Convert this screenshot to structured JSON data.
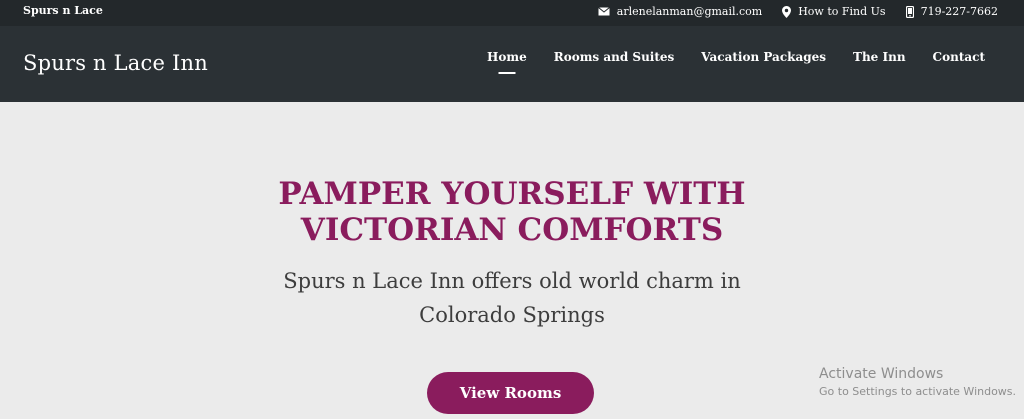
{
  "topbar": {
    "site_short": "Spurs n Lace",
    "email": "arlenelanman@gmail.com",
    "location": "How to Find Us",
    "phone": "719-227-7662"
  },
  "header": {
    "brand": "Spurs n Lace Inn",
    "nav": [
      "Home",
      "Rooms and Suites",
      "Vacation Packages",
      "The Inn",
      "Contact"
    ],
    "active_nav": "Home"
  },
  "hero": {
    "headline_line1": "PAMPER YOURSELF WITH",
    "headline_line2": "VICTORIAN COMFORTS",
    "subline_line1": "Spurs n Lace Inn offers old world charm in",
    "subline_line2": "Colorado Springs",
    "cta_label": "View Rooms"
  },
  "watermark": {
    "title": "Activate Windows",
    "subtitle": "Go to Settings to activate Windows."
  },
  "colors": {
    "accent": "#8a1c5d",
    "header_bg": "#2b3135",
    "topbar_bg": "#23282b",
    "hero_bg": "#ebebeb"
  },
  "icons": {
    "email": "envelope-icon",
    "location": "map-pin-icon",
    "phone": "phone-icon"
  }
}
